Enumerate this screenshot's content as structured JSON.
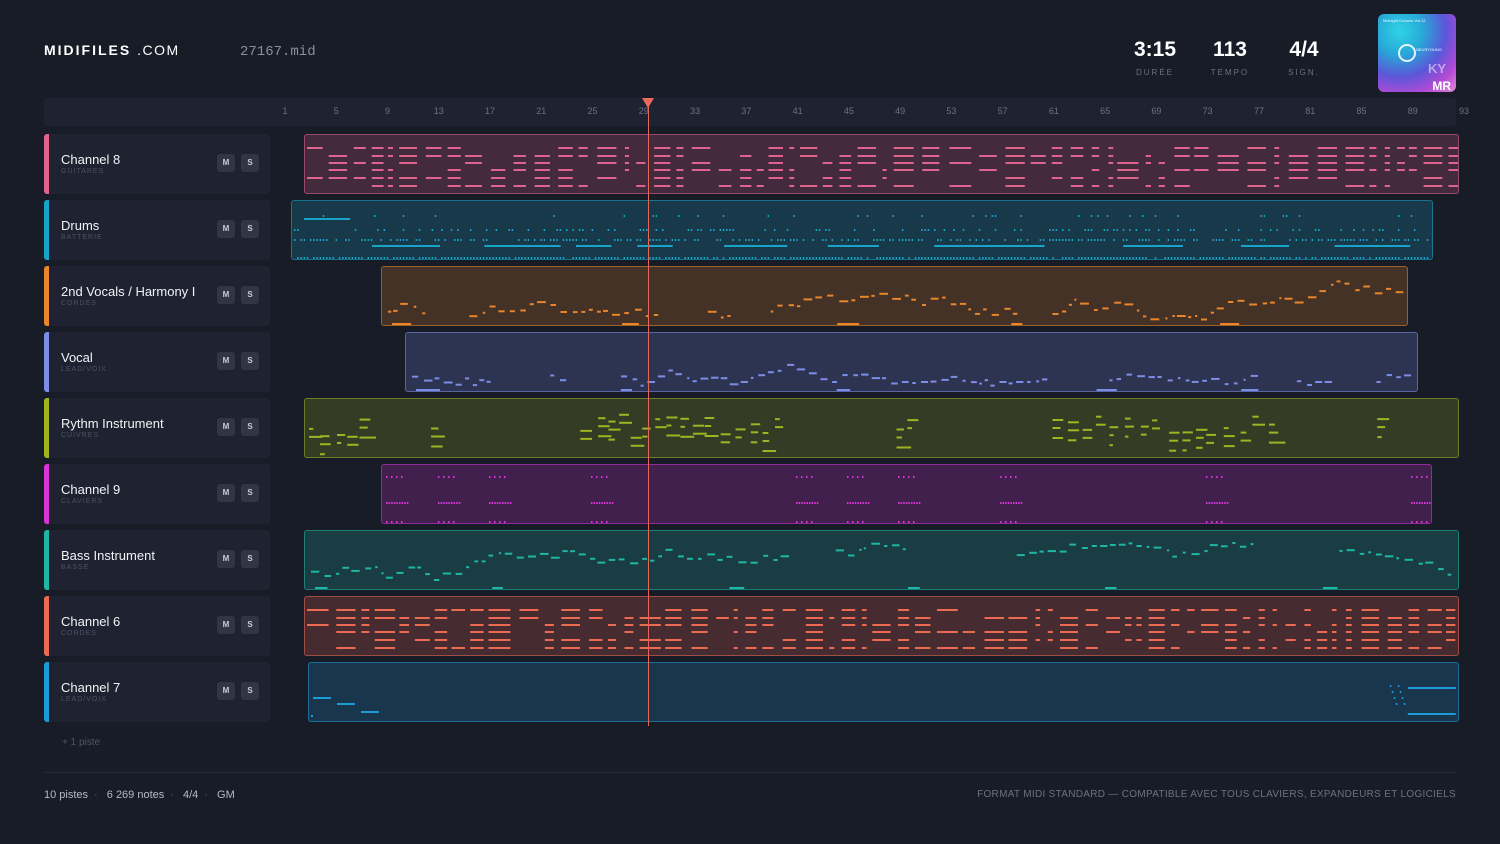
{
  "header": {
    "logo_bold": "MIDIFILES",
    "logo_light": ".COM",
    "filename": "27167.mid",
    "stats": [
      {
        "value": "3:15",
        "label": "DURÉE"
      },
      {
        "value": "113",
        "label": "TEMPO"
      },
      {
        "value": "4/4",
        "label": "SIGN."
      }
    ],
    "cover": {
      "small_text": "Midnight Dreams Vol.12",
      "mark": "NEURYOUNG",
      "ky": "KY",
      "mr": "MR"
    }
  },
  "ruler": {
    "ticks": [
      "1",
      "5",
      "9",
      "13",
      "17",
      "21",
      "25",
      "29",
      "33",
      "37",
      "41",
      "45",
      "49",
      "53",
      "57",
      "61",
      "65",
      "69",
      "73",
      "77",
      "81",
      "85",
      "89",
      "93"
    ]
  },
  "playhead_bar": 29.3,
  "tracks": [
    {
      "name": "Channel 8",
      "sub": "GUITARES",
      "color": "#e0628f",
      "start_bar": 2.5,
      "end_bar": 92.6,
      "pattern": "rows"
    },
    {
      "name": "Drums",
      "sub": "BATTERIE",
      "color": "#17a4c8",
      "start_bar": 1.5,
      "end_bar": 90.6,
      "pattern": "drums"
    },
    {
      "name": "2nd Vocals / Harmony I",
      "sub": "CORDES",
      "color": "#e9852a",
      "start_bar": 8.5,
      "end_bar": 88.6,
      "pattern": "melody"
    },
    {
      "name": "Vocal",
      "sub": "LEAD/VOIX",
      "color": "#7c8de8",
      "start_bar": 10.4,
      "end_bar": 89.4,
      "pattern": "melody"
    },
    {
      "name": "Rythm Instrument",
      "sub": "CUIVRES",
      "color": "#a0b322",
      "start_bar": 2.5,
      "end_bar": 92.6,
      "pattern": "chords"
    },
    {
      "name": "Channel 9",
      "sub": "CLAVIERS",
      "color": "#d934d8",
      "start_bar": 8.5,
      "end_bar": 90.5,
      "pattern": "dots"
    },
    {
      "name": "Bass Instrument",
      "sub": "BASSE",
      "color": "#1fb6a5",
      "start_bar": 2.5,
      "end_bar": 92.6,
      "pattern": "melody"
    },
    {
      "name": "Channel 6",
      "sub": "CORDES",
      "color": "#ec6a51",
      "start_bar": 2.5,
      "end_bar": 92.6,
      "pattern": "rows"
    },
    {
      "name": "Channel 7",
      "sub": "LEAD/VOIX",
      "color": "#1d9ad8",
      "start_bar": 2.8,
      "end_bar": 92.6,
      "pattern": "sparse"
    }
  ],
  "buttons": {
    "mute": "M",
    "solo": "S"
  },
  "more_tracks": "+ 1 piste",
  "footer": {
    "tracks": "10 pistes",
    "notes": "6 269 notes",
    "signature": "4/4",
    "standard": "GM",
    "right": "FORMAT MIDI STANDARD — COMPATIBLE AVEC TOUS CLAVIERS, EXPANDEURS ET LOGICIELS"
  }
}
